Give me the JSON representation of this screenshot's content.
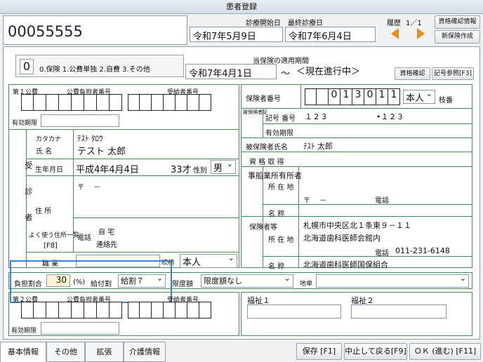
{
  "window_title": "患者登録",
  "patient_id": "00055555",
  "header": {
    "start_label": "診療開始日",
    "last_label": "最終診療日",
    "start_date": "令和7年5月9日",
    "last_date": "令和7年6月4日",
    "history_label": "履歴",
    "history_page": "1／1",
    "btn_check_info": "資格確認情報",
    "btn_new_insurance": "新保険作成"
  },
  "type": {
    "value": "0",
    "options": "0.保険 1.公費単独 2.自費 3.その他"
  },
  "period": {
    "label": "当保険の適用期間",
    "from": "令和7年4月1日",
    "tilde": "～",
    "to": "＜現在進行中＞"
  },
  "buttons": {
    "shikaku": "資格確認",
    "kigou": "記号参照[F3]"
  },
  "kohi1": {
    "label": "第１公費",
    "futan_label": "公費負担者番号",
    "jukyu_label": "受給者番号",
    "valid_label": "有効期限"
  },
  "kohi2": {
    "label": "第２公費",
    "futan_label": "公費負担者番号",
    "jukyu_label": "受給者番号",
    "valid_label": "有効期限"
  },
  "insurer": {
    "label": "保険者番号",
    "digits": [
      "0",
      "1",
      "3",
      "0",
      "1",
      "1"
    ],
    "relation": "本人",
    "edaban": "枝番"
  },
  "insured": {
    "side_label": "被保険者証",
    "kigo_label": "記号 番号",
    "kigo": "１２３",
    "bangou": "•１２３",
    "valid_label": "有効期限",
    "name_label": "被保険者氏名",
    "name": "ﾃｽﾄ 太郎",
    "shutoku_label": "資 格 取 得"
  },
  "jigyo": {
    "side_label": "事船業所有所者",
    "address_label": "所 在 地",
    "postal": "〒 　－",
    "tel_label": "電話",
    "name_label": "名 称"
  },
  "hoken": {
    "side_label": "保険者等",
    "address_label": "所 在 地",
    "address1": "札幌市中央区北１条東９－１１",
    "address2": "北海道歯科医師会館内",
    "tel_label": "電話",
    "tel": "011-231-6148",
    "name_label": "名 称",
    "name": "北海道歯科医師国保組合"
  },
  "patient": {
    "side_label": "受診者",
    "kana_label": "カタカナ",
    "kana": "ﾃｽﾄ ﾀﾛｳ",
    "name_label": "氏 名",
    "name": "テスト 太郎",
    "birth_label": "生年月日",
    "birth": "平成4年4月4日",
    "age": "33才",
    "sex_label": "性別",
    "sex": "男",
    "postal": "〒 　－",
    "address_label": "住 所",
    "freq_addr_label": "よく使う住所一覧",
    "freq_addr_key": "[F8]",
    "tel_label": "電話",
    "tel_home": "自 宅",
    "tel_contact": "連絡先",
    "job_label": "職 業",
    "zoku_label": "続柄",
    "zoku": "本人"
  },
  "futan": {
    "label": "負担割合",
    "value": "30",
    "unit": "(%)",
    "kyufu_label": "給付割",
    "kyufu": "給割７",
    "gendo_label": "限度額",
    "gendo": "限度額なし",
    "chiban_label": "地単"
  },
  "fukushi": {
    "label1": "福祉１",
    "label2": "福祉２"
  },
  "tabs": [
    "基本情報",
    "その他",
    "拡張",
    "介護情報"
  ],
  "footer": {
    "save": "保存 [F1]",
    "cancel": "中止して戻る[F9]",
    "ok": "ＯＫ (進む) [F11]"
  },
  "colors": {
    "accent_border": "#3a7fd0",
    "arrow": "#e8901c",
    "green_line": "#4c8c5a"
  }
}
